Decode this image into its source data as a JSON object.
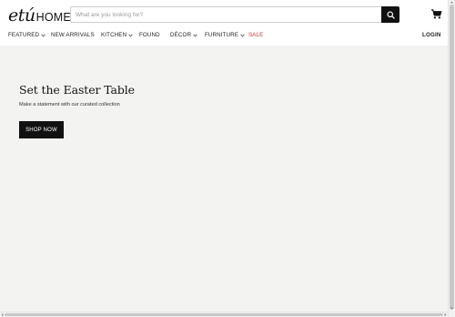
{
  "header": {
    "logo_script": "etú",
    "logo_text": "HOME",
    "search": {
      "placeholder": "What are you looking for?",
      "value": "",
      "icon": "search-icon"
    },
    "cart_icon": "cart-icon",
    "login_label": "LOGIN"
  },
  "nav": {
    "items": [
      {
        "label": "FEATURED",
        "has_dropdown": true
      },
      {
        "label": "NEW ARRIVALS",
        "has_dropdown": false
      },
      {
        "label": "KITCHEN",
        "has_dropdown": true
      },
      {
        "label": "FOUND",
        "has_dropdown": false
      },
      {
        "label": "DÉCOR",
        "has_dropdown": true
      },
      {
        "label": "FURNITURE",
        "has_dropdown": true
      },
      {
        "label": "SALE",
        "has_dropdown": false
      }
    ],
    "sale_color": "#c0392b"
  },
  "hero": {
    "title": "Set the Easter Table",
    "subtitle": "Make a statement with our curated collection",
    "button_label": "SHOP NOW",
    "background": "#f3f4f2"
  }
}
